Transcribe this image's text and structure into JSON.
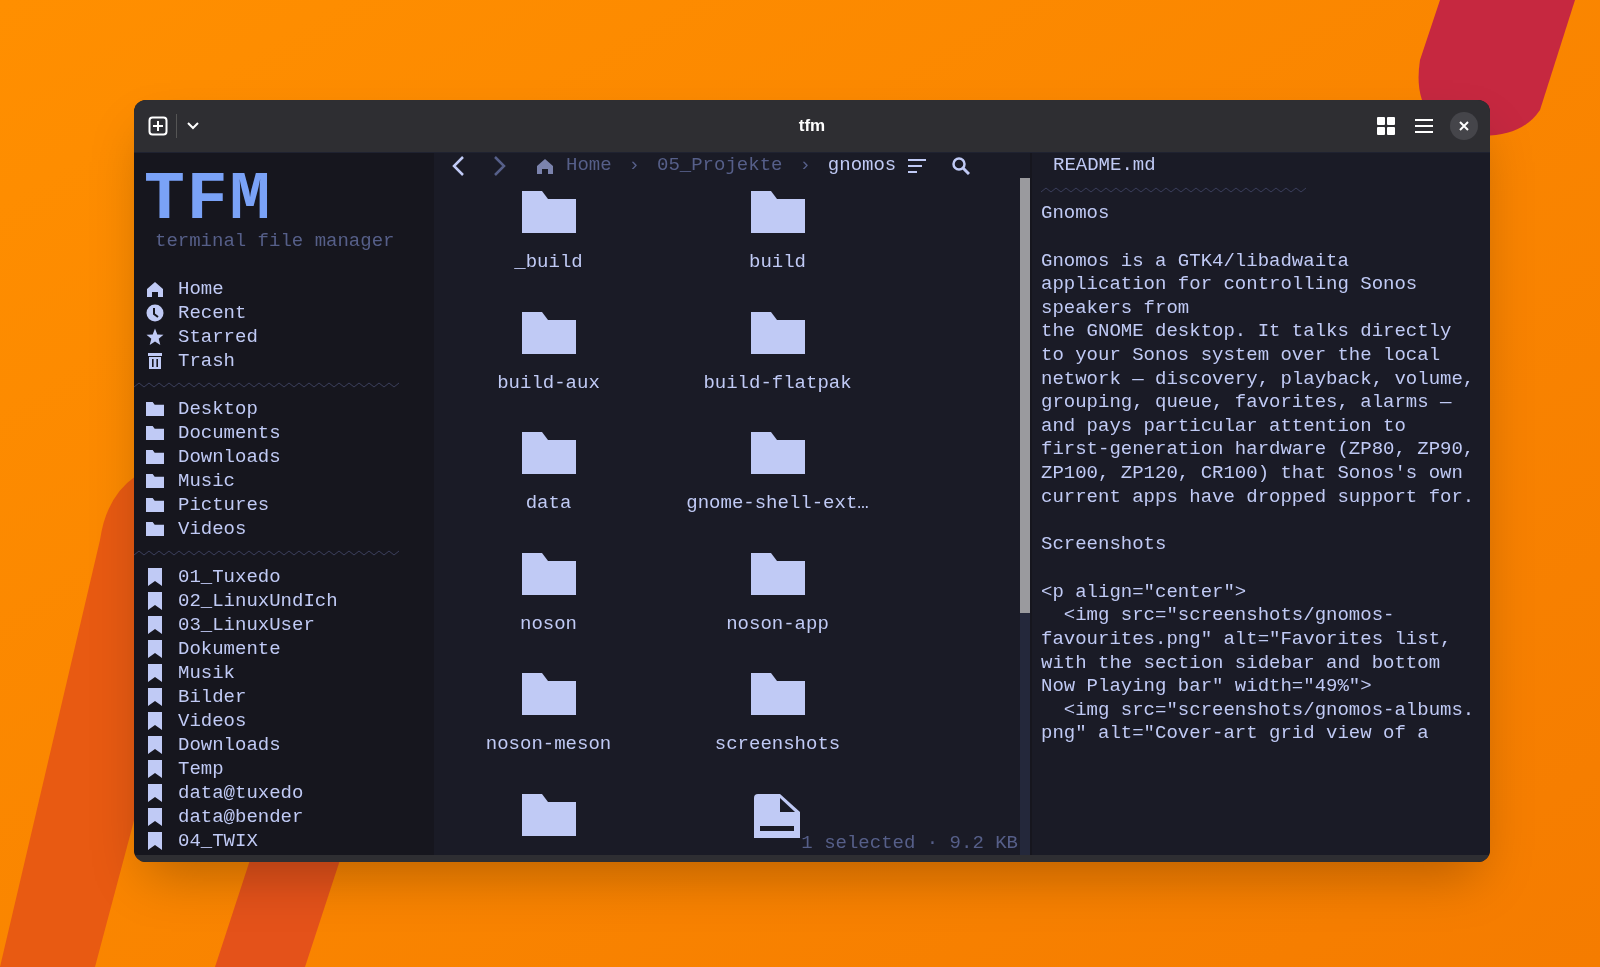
{
  "window": {
    "title": "tfm"
  },
  "sidebar": {
    "logo": "TFM",
    "subtitle": "terminal file manager",
    "places": [
      {
        "kind": "home",
        "label": "Home"
      },
      {
        "kind": "recent",
        "label": "Recent"
      },
      {
        "kind": "starred",
        "label": "Starred"
      },
      {
        "kind": "trash",
        "label": "Trash"
      }
    ],
    "folders": [
      {
        "label": "Desktop"
      },
      {
        "label": "Documents"
      },
      {
        "label": "Downloads"
      },
      {
        "label": "Music"
      },
      {
        "label": "Pictures"
      },
      {
        "label": "Videos"
      }
    ],
    "bookmarks": [
      {
        "label": "01_Tuxedo"
      },
      {
        "label": "02_LinuxUndIch"
      },
      {
        "label": "03_LinuxUser"
      },
      {
        "label": "Dokumente"
      },
      {
        "label": "Musik"
      },
      {
        "label": "Bilder"
      },
      {
        "label": "Videos"
      },
      {
        "label": "Downloads"
      },
      {
        "label": "Temp"
      },
      {
        "label": "data@tuxedo"
      },
      {
        "label": "data@bender"
      },
      {
        "label": "04_TWIX"
      }
    ]
  },
  "navigation": {
    "back_disabled": false,
    "forward_disabled": true,
    "breadcrumbs": [
      {
        "label": "Home",
        "current": false,
        "home": true
      },
      {
        "label": "05_Projekte",
        "current": false,
        "home": false
      },
      {
        "label": "gnomos",
        "current": true,
        "home": false
      }
    ],
    "separator": "›"
  },
  "files": [
    {
      "kind": "folder",
      "name": "_build"
    },
    {
      "kind": "folder",
      "name": "build"
    },
    {
      "kind": "folder",
      "name": "build-aux"
    },
    {
      "kind": "folder",
      "name": "build-flatpak"
    },
    {
      "kind": "folder",
      "name": "data"
    },
    {
      "kind": "folder",
      "name": "gnome-shell-ext…"
    },
    {
      "kind": "folder",
      "name": "noson"
    },
    {
      "kind": "folder",
      "name": "noson-app"
    },
    {
      "kind": "folder",
      "name": "noson-meson"
    },
    {
      "kind": "folder",
      "name": "screenshots"
    },
    {
      "kind": "folder"
    },
    {
      "kind": "file"
    }
  ],
  "status": "1 selected · 9.2 KB",
  "preview": {
    "title": "README.md",
    "blocks": [
      {
        "lines": [
          "Gnomos"
        ]
      },
      {
        "lines": [
          "Gnomos is a GTK4/libadwaita",
          "application for controlling Sonos",
          "speakers from",
          "the GNOME desktop. It talks directly",
          "to your Sonos system over the local",
          "network — discovery, playback, volume,",
          "grouping, queue, favorites, alarms —",
          "and pays particular attention to",
          "first-generation hardware (ZP80, ZP90,",
          "ZP100, ZP120, CR100) that Sonos's own",
          "current apps have dropped support for."
        ]
      },
      {
        "lines": [
          "Screenshots"
        ]
      },
      {
        "lines": [
          "<p align=\"center\">",
          "  <img src=\"screenshots/gnomos-",
          "favourites.png\" alt=\"Favorites list,",
          "with the section sidebar and bottom",
          "Now Playing bar\" width=\"49%\">",
          "  <img src=\"screenshots/gnomos-albums.",
          "png\" alt=\"Cover-art grid view of a"
        ]
      }
    ]
  }
}
